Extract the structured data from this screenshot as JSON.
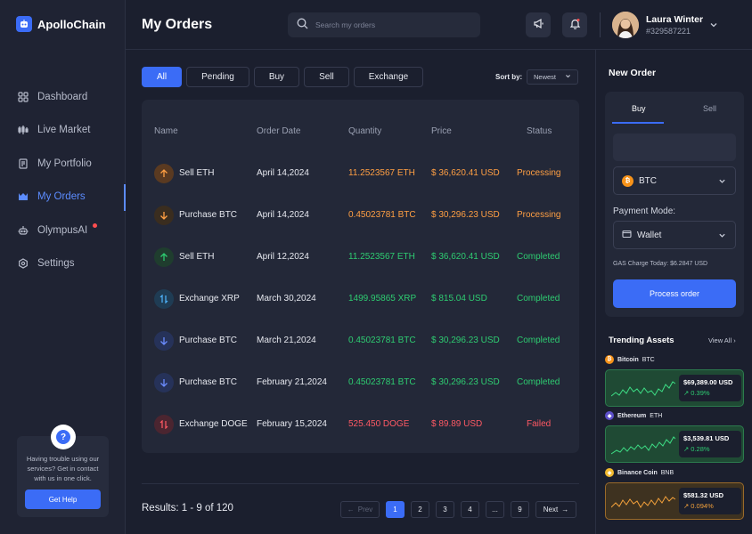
{
  "app": {
    "name": "ApolloChain"
  },
  "sidebar": {
    "items": [
      {
        "label": "Dashboard",
        "icon": "dashboard-icon",
        "active": false
      },
      {
        "label": "Live Market",
        "icon": "live-market-icon",
        "active": false
      },
      {
        "label": "My Portfolio",
        "icon": "portfolio-icon",
        "active": false
      },
      {
        "label": "My Orders",
        "icon": "orders-icon",
        "active": true
      },
      {
        "label": "OlympusAI",
        "icon": "robot-icon",
        "active": false
      },
      {
        "label": "Settings",
        "icon": "gear-icon",
        "active": false
      }
    ],
    "help": {
      "text": "Having trouble using our services? Get in contact with us in one click.",
      "button": "Get Help"
    }
  },
  "header": {
    "title": "My Orders",
    "search_placeholder": "Search my orders",
    "user": {
      "name": "Laura Winter",
      "id": "#329587221"
    }
  },
  "filters": {
    "tabs": [
      "All",
      "Pending",
      "Buy",
      "Sell",
      "Exchange"
    ],
    "active": "All",
    "sort_label": "Sort by:",
    "sort_value": "Newest"
  },
  "table": {
    "headers": [
      "Name",
      "Order Date",
      "Quantity",
      "Price",
      "Status"
    ],
    "rows": [
      {
        "name": "Sell ETH",
        "date": "April 14,2024",
        "quantity": "11.2523567 ETH",
        "price": "$ 36,620.41 USD",
        "status": "Processing"
      },
      {
        "name": "Purchase BTC",
        "date": "April 14,2024",
        "quantity": "0.45023781 BTC",
        "price": "$ 30,296.23 USD",
        "status": "Processing"
      },
      {
        "name": "Sell ETH",
        "date": "April 12,2024",
        "quantity": "11.2523567 ETH",
        "price": "$ 36,620.41 USD",
        "status": "Completed"
      },
      {
        "name": "Exchange XRP",
        "date": "March 30,2024",
        "quantity": "1499.95865 XRP",
        "price": "$ 815.04 USD",
        "status": "Completed"
      },
      {
        "name": "Purchase BTC",
        "date": "March 21,2024",
        "quantity": "0.45023781 BTC",
        "price": "$ 30,296.23 USD",
        "status": "Completed"
      },
      {
        "name": "Purchase BTC",
        "date": "February 21,2024",
        "quantity": "0.45023781 BTC",
        "price": "$ 30,296.23 USD",
        "status": "Completed"
      },
      {
        "name": "Exchange DOGE",
        "date": "February 15,2024",
        "quantity": "525.450 DOGE",
        "price": "$ 89.89 USD",
        "status": "Failed"
      }
    ]
  },
  "pagination": {
    "results": "Results: 1 - 9 of 120",
    "prev": "Prev",
    "next": "Next",
    "pages": [
      "1",
      "2",
      "3",
      "4",
      "...",
      "9"
    ],
    "current": "1"
  },
  "new_order": {
    "title": "New Order",
    "tabs": [
      "Buy",
      "Sell"
    ],
    "active_tab": "Buy",
    "coin": "BTC",
    "payment_label": "Payment Mode:",
    "payment_value": "Wallet",
    "gas": "GAS Charge Today: $6.2847 USD",
    "button": "Process order"
  },
  "trending": {
    "title": "Trending Assets",
    "view_all": "View All",
    "assets": [
      {
        "name": "Bitcoin",
        "ticker": "BTC",
        "price": "$69,389.00 USD",
        "change": "0.39%"
      },
      {
        "name": "Ethereum",
        "ticker": "ETH",
        "price": "$3,539.81 USD",
        "change": "0.28%"
      },
      {
        "name": "Binance Coin",
        "ticker": "BNB",
        "price": "$581.32 USD",
        "change": "0.094%"
      }
    ]
  },
  "colors": {
    "accent": "#3b6cf6",
    "processing": "#ff9f43",
    "completed": "#2ecc71",
    "failed": "#ff5964"
  }
}
